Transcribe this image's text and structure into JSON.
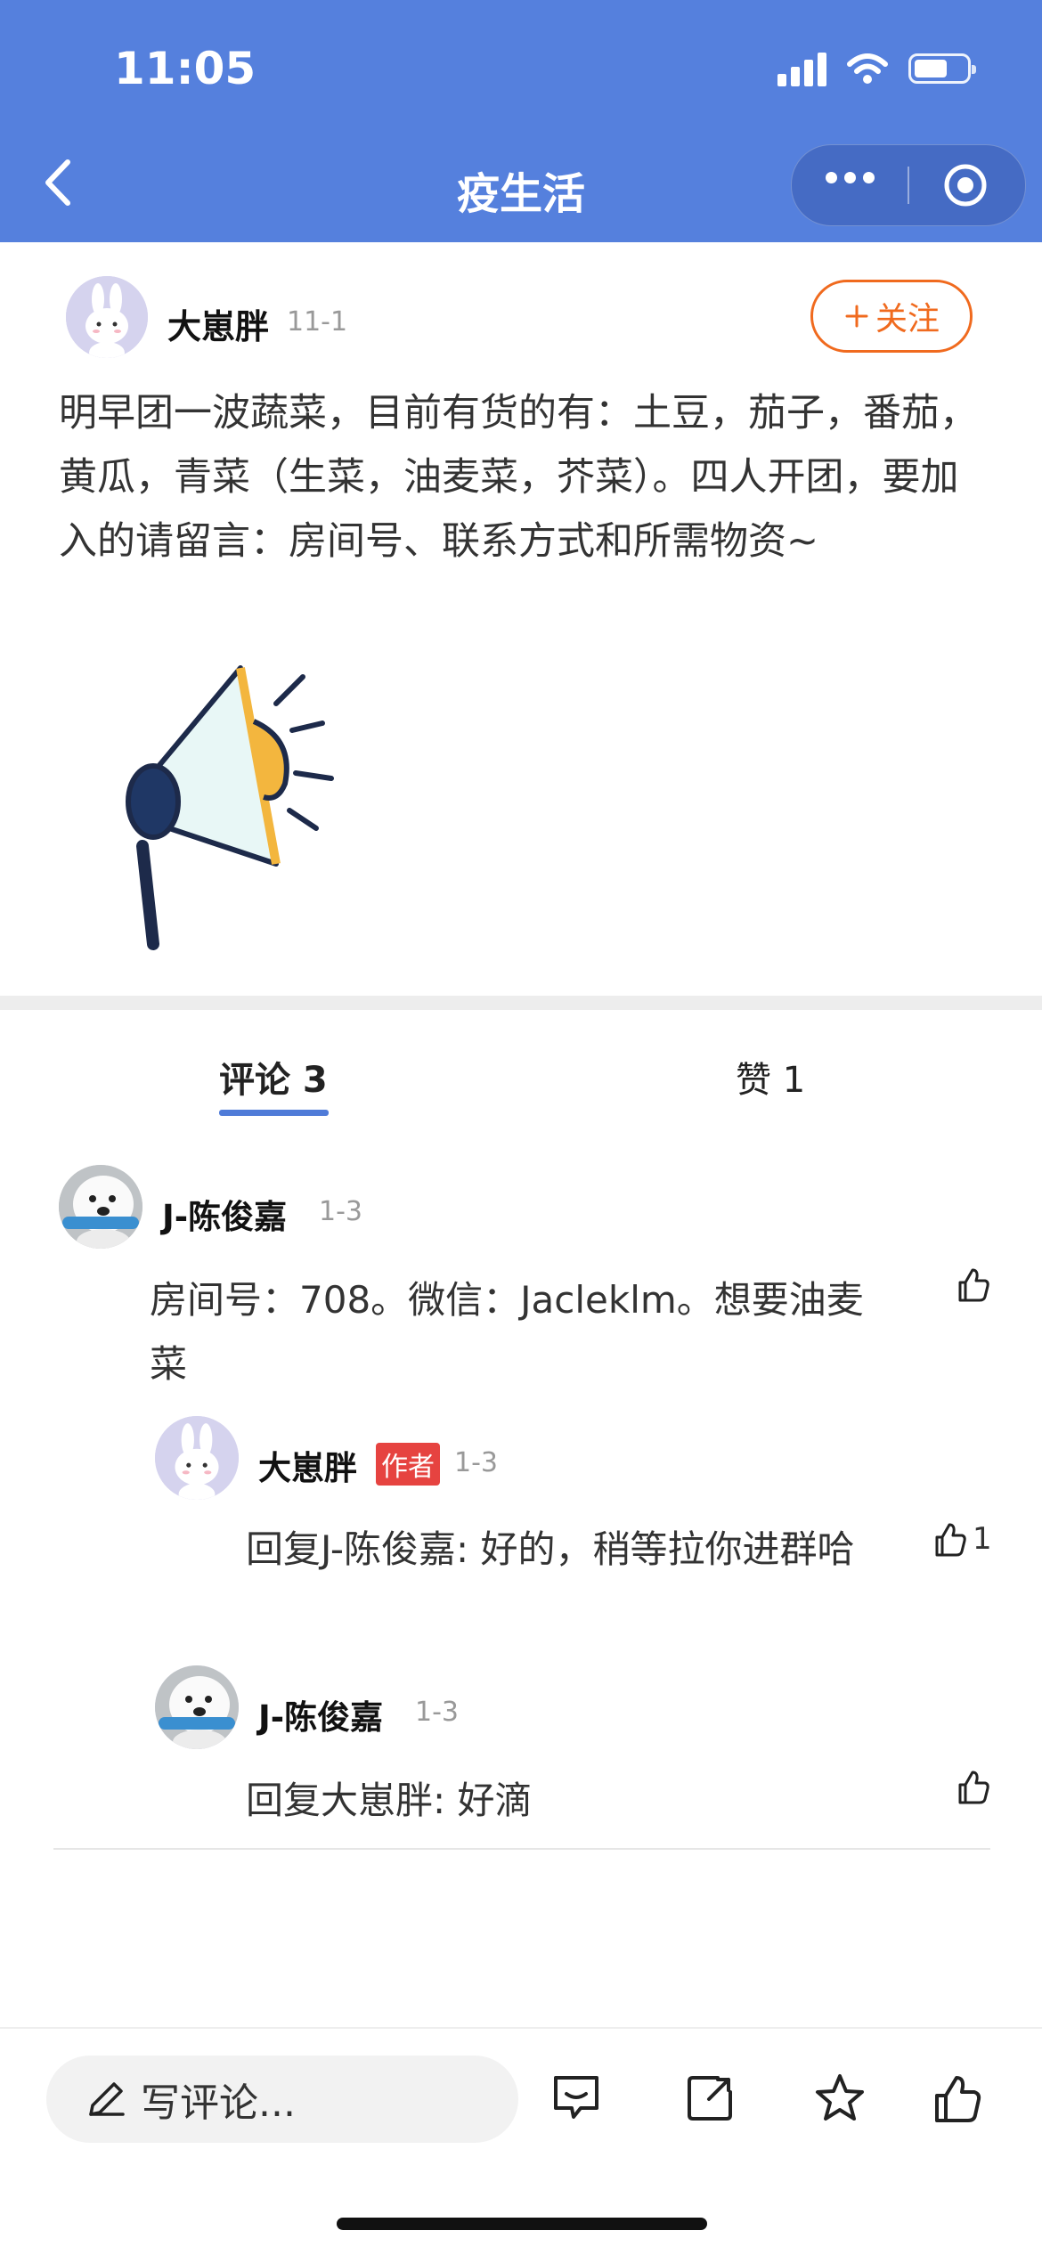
{
  "status_bar": {
    "time": "11:05"
  },
  "nav": {
    "title": "疫生活"
  },
  "post": {
    "author": "大崽胖",
    "date": "11-1",
    "follow_label": "关注",
    "text": "明早团一波蔬菜，目前有货的有：土豆，茄子，番茄，黄瓜，青菜（生菜，油麦菜，芥菜）。四人开团，要加入的请留言：房间号、联系方式和所需物资~"
  },
  "tabs": [
    {
      "label": "评论 3"
    },
    {
      "label": "赞 1"
    }
  ],
  "comments": [
    {
      "author": "J-陈俊嘉",
      "date": "1-3",
      "text": "房间号：708。微信：Jaclеklm。想要油麦菜",
      "likes": ""
    },
    {
      "author": "大崽胖",
      "badge": "作者",
      "date": "1-3",
      "text": "回复J-陈俊嘉: 好的，稍等拉你进群哈",
      "likes": "1"
    },
    {
      "author": "J-陈俊嘉",
      "date": "1-3",
      "text": "回复大崽胖: 好滴",
      "likes": ""
    }
  ],
  "bottom_bar": {
    "input_placeholder": "写评论...",
    "icons": [
      "comment-icon",
      "share-icon",
      "star-icon",
      "like-icon"
    ]
  },
  "colors": {
    "header": "#5580dd",
    "accent_orange": "#f06a1e",
    "tab_underline": "#4f7bd8",
    "author_badge": "#e64340"
  }
}
